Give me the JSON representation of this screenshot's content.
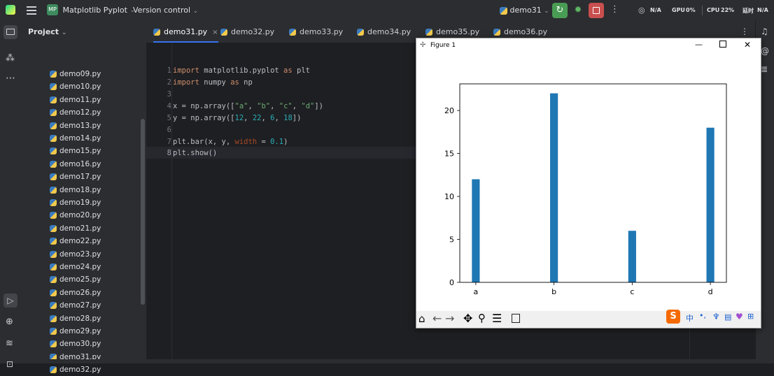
{
  "titlebar": {
    "project_badge": "MP",
    "project_name": "Matplotlib Pyplot",
    "version_control": "Version control",
    "run_config": "demo31",
    "net_label": "N/A",
    "gpu_label": "GPU",
    "gpu_value": "0%",
    "cpu_label": "CPU",
    "cpu_value": "22%",
    "latency_label": "延时",
    "latency_value": "N/A"
  },
  "project_panel": {
    "title": "Project",
    "files": [
      "demo09.py",
      "demo10.py",
      "demo11.py",
      "demo12.py",
      "demo13.py",
      "demo14.py",
      "demo15.py",
      "demo16.py",
      "demo17.py",
      "demo18.py",
      "demo19.py",
      "demo20.py",
      "demo21.py",
      "demo22.py",
      "demo23.py",
      "demo24.py",
      "demo25.py",
      "demo26.py",
      "demo27.py",
      "demo28.py",
      "demo29.py",
      "demo30.py",
      "demo31.py",
      "demo32.py"
    ]
  },
  "tabs": [
    {
      "label": "demo31.py",
      "active": true
    },
    {
      "label": "demo32.py",
      "active": false
    },
    {
      "label": "demo33.py",
      "active": false
    },
    {
      "label": "demo34.py",
      "active": false
    },
    {
      "label": "demo35.py",
      "active": false
    },
    {
      "label": "demo36.py",
      "active": false
    }
  ],
  "code_lines": [
    "1",
    "2",
    "3",
    "4",
    "5",
    "6",
    "7",
    "8"
  ],
  "code": {
    "l1_kw1": "import",
    "l1_mod": " matplotlib.pyplot ",
    "l1_kw2": "as",
    "l1_alias": " plt",
    "l2_kw1": "import",
    "l2_mod": " numpy ",
    "l2_kw2": "as",
    "l2_alias": " np",
    "l4_a": "x = np.array([",
    "l4_s1": "\"a\"",
    "l4_c1": ", ",
    "l4_s2": "\"b\"",
    "l4_c2": ", ",
    "l4_s3": "\"c\"",
    "l4_c3": ", ",
    "l4_s4": "\"d\"",
    "l4_end": "])",
    "l5_a": "y = np.array([",
    "l5_n1": "12",
    "l5_c1": ", ",
    "l5_n2": "22",
    "l5_c2": ", ",
    "l5_n3": "6",
    "l5_c3": ", ",
    "l5_n4": "18",
    "l5_end": "])",
    "l7_a": "plt.bar(x, y, ",
    "l7_p": "width",
    "l7_eq": " = ",
    "l7_n": "0.1",
    "l7_end": ")",
    "l8": "plt.show()"
  },
  "figure": {
    "window_title": "Figure 1"
  },
  "chart_data": {
    "type": "bar",
    "categories": [
      "a",
      "b",
      "c",
      "d"
    ],
    "values": [
      12,
      22,
      6,
      18
    ],
    "ylim": [
      0,
      23.1
    ],
    "yticks": [
      0,
      5,
      10,
      15,
      20
    ],
    "bar_color": "#1f77b4",
    "grid": false
  },
  "ime": {
    "logo": "S",
    "lang": "中"
  }
}
